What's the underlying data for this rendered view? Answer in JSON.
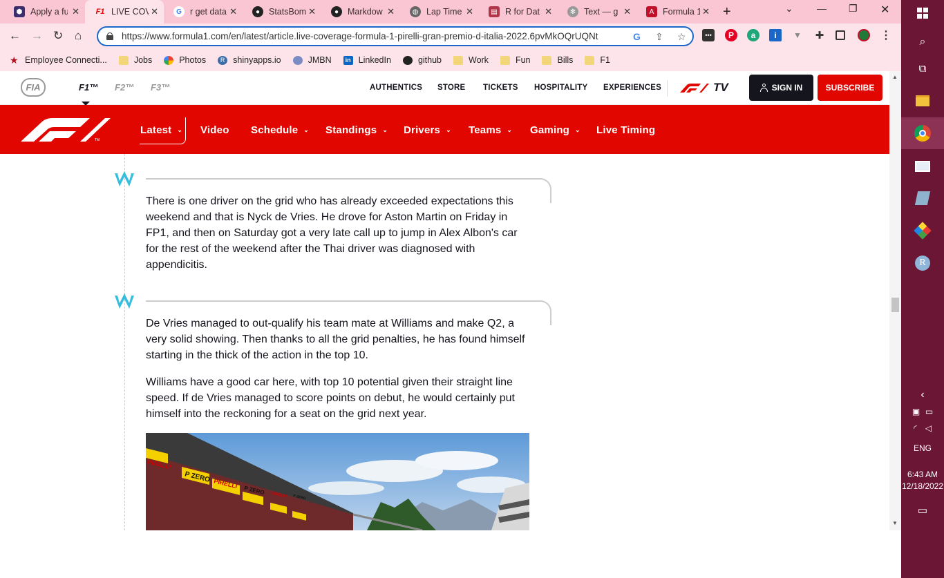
{
  "tabs": [
    {
      "label": "Apply a fu",
      "icon": "hexagon-app-icon",
      "color": "#3b2e6e"
    },
    {
      "label": "LIVE COV",
      "icon": "f1-icon",
      "color": "#e10600"
    },
    {
      "label": "r get data",
      "icon": "google-icon",
      "color": "#ffffff"
    },
    {
      "label": "StatsBom",
      "icon": "github-icon",
      "color": "#222222"
    },
    {
      "label": "Markdow",
      "icon": "github-icon",
      "color": "#222222"
    },
    {
      "label": "Lap Time",
      "icon": "globe-icon",
      "color": "#555555"
    },
    {
      "label": "R for Dat",
      "icon": "book-icon",
      "color": "#b2364a"
    },
    {
      "label": "Text — g",
      "icon": "gear-icon",
      "color": "#777777"
    },
    {
      "label": "Formula 1",
      "icon": "formula-icon",
      "color": "#c0102a"
    }
  ],
  "url": "https://www.formula1.com/en/latest/article.live-coverage-formula-1-pirelli-gran-premio-d-italia-2022.6pvMkOQrUQNt",
  "bookmarks": [
    {
      "label": "Employee Connecti...",
      "icon": "star-icon"
    },
    {
      "label": "Jobs",
      "icon": "folder-icon"
    },
    {
      "label": "Photos",
      "icon": "pinwheel-icon"
    },
    {
      "label": "shinyapps.io",
      "icon": "r-icon"
    },
    {
      "label": "JMBN",
      "icon": "globe-icon"
    },
    {
      "label": "LinkedIn",
      "icon": "linkedin-icon"
    },
    {
      "label": "github",
      "icon": "github-icon"
    },
    {
      "label": "Work",
      "icon": "folder-icon"
    },
    {
      "label": "Fun",
      "icon": "folder-icon"
    },
    {
      "label": "Bills",
      "icon": "folder-icon"
    },
    {
      "label": "F1",
      "icon": "folder-icon"
    }
  ],
  "topnav": {
    "fia": "FIA",
    "series": [
      "F1™",
      "F2™",
      "F3™"
    ],
    "links": [
      "AUTHENTICS",
      "STORE",
      "TICKETS",
      "HOSPITALITY",
      "EXPERIENCES"
    ],
    "tv": "TV",
    "signin": "SIGN IN",
    "subscribe": "SUBSCRIBE"
  },
  "mainnav": [
    {
      "label": "Latest",
      "dropdown": true
    },
    {
      "label": "Video",
      "dropdown": false
    },
    {
      "label": "Schedule",
      "dropdown": true
    },
    {
      "label": "Standings",
      "dropdown": true
    },
    {
      "label": "Drivers",
      "dropdown": true
    },
    {
      "label": "Teams",
      "dropdown": true
    },
    {
      "label": "Gaming",
      "dropdown": true
    },
    {
      "label": "Live Timing",
      "dropdown": false
    }
  ],
  "posts": [
    {
      "team_logo": "W",
      "paragraphs": [
        "There is one driver on the grid who has already exceeded expectations this weekend and that is Nyck de Vries. He drove for Aston Martin on Friday in FP1, and then on Saturday got a very late call up to jump in Alex Albon's car for the rest of the weekend after the Thai driver was diagnosed with appendicitis."
      ]
    },
    {
      "team_logo": "W",
      "paragraphs": [
        "De Vries managed to out-qualify his team mate at Williams and make Q2, a very solid showing. Then thanks to all the grid penalties, he has found himself starting in the thick of the action in the top 10.",
        "Williams have a good car here, with top 10 potential given their straight line speed. If de Vries managed to score points on debut, he would certainly put himself into the reckoning for a seat on the grid next year."
      ]
    }
  ],
  "photo_signage": [
    "PIRELLI",
    "P ZERO",
    "PIRELLI",
    "P ZERO",
    "PIRELLI",
    "P ZERO"
  ],
  "taskbar": {
    "lang": "ENG",
    "time": "6:43 AM",
    "date": "12/18/2022"
  },
  "colors": {
    "f1_red": "#e10600",
    "williams_blue": "#37bedd",
    "chrome_pink": "#fbc6d3",
    "taskbar": "#6a1634"
  }
}
